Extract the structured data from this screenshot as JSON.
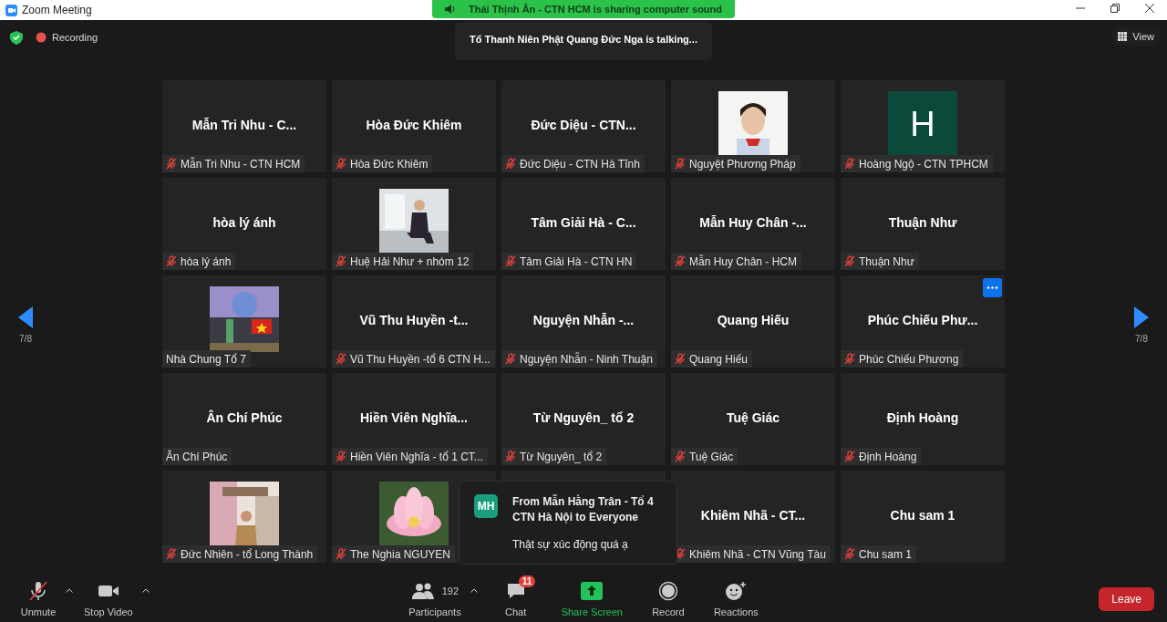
{
  "window": {
    "title": "Zoom Meeting"
  },
  "sharing_banner": "Thái Thịnh Ân - CTN HCM is sharing computer sound",
  "top_bar": {
    "recording": "Recording",
    "talking": "Tổ Thanh Niên Phật Quang Đức Nga is talking...",
    "view": "View"
  },
  "pager": {
    "left": "7/8",
    "right": "7/8"
  },
  "tiles": [
    {
      "kind": "name",
      "name": "Mẫn Tri Nhu - C...",
      "label": "Mẫn Tri Nhu - CTN HCM",
      "muted": true
    },
    {
      "kind": "name",
      "name": "Hòa Đức Khiêm",
      "label": "Hòa Đức Khiêm",
      "muted": true
    },
    {
      "kind": "name",
      "name": "Đức Diệu - CTN...",
      "label": "Đức Diệu - CTN Hà Tĩnh",
      "muted": true
    },
    {
      "kind": "picture",
      "label": "Nguyệt Phương Pháp",
      "muted": true
    },
    {
      "kind": "avatar",
      "initial": "H",
      "label": "Hoàng Ngộ - CTN TPHCM",
      "muted": true
    },
    {
      "kind": "name",
      "name": "hòa lý ánh",
      "label": "hòa lý ánh",
      "muted": true
    },
    {
      "kind": "picture",
      "label": "Huệ Hải Như + nhóm 12",
      "muted": true
    },
    {
      "kind": "name",
      "name": "Tâm Giải Hà - C...",
      "label": "Tâm Giải Hà - CTN HN",
      "muted": true
    },
    {
      "kind": "name",
      "name": "Mẫn Huy Chân -...",
      "label": "Mẫn Huy Chân - HCM",
      "muted": true
    },
    {
      "kind": "name",
      "name": "Thuận Như",
      "label": "Thuận Như",
      "muted": true
    },
    {
      "kind": "picture",
      "label": "Nhà Chung Tổ 7",
      "muted": false
    },
    {
      "kind": "name",
      "name": "Vũ Thu Huyền -t...",
      "label": "Vũ Thu Huyền -tổ 6 CTN H...",
      "muted": true
    },
    {
      "kind": "name",
      "name": "Nguyện Nhẫn -...",
      "label": "Nguyện Nhẫn - Ninh Thuận",
      "muted": true
    },
    {
      "kind": "name",
      "name": "Quang Hiếu",
      "label": "Quang Hiếu",
      "muted": true
    },
    {
      "kind": "name",
      "name": "Phúc Chiếu Phư...",
      "label": "Phúc Chiếu Phương",
      "muted": true,
      "hovered": true
    },
    {
      "kind": "name",
      "name": "Ân Chí Phúc",
      "label": "Ân Chí Phúc",
      "muted": false
    },
    {
      "kind": "name",
      "name": "Hiền Viên Nghĩa...",
      "label": "Hiền Viên Nghĩa - tổ 1 CT...",
      "muted": true
    },
    {
      "kind": "name",
      "name": "Từ Nguyên_ tổ 2",
      "label": "Từ Nguyên_ tổ 2",
      "muted": true
    },
    {
      "kind": "name",
      "name": "Tuệ Giác",
      "label": "Tuệ Giác",
      "muted": true
    },
    {
      "kind": "name",
      "name": "Định Hoàng",
      "label": "Định Hoàng",
      "muted": true
    },
    {
      "kind": "picture",
      "label": "Đức Nhiên - tổ Long Thành",
      "muted": true
    },
    {
      "kind": "picture",
      "label": "The Nghia NGUYEN",
      "muted": true
    },
    {
      "kind": "covered"
    },
    {
      "kind": "name",
      "name": "Khiêm Nhã - CT...",
      "label": "Khiêm Nhã - CTN Vũng Tàu",
      "muted": true
    },
    {
      "kind": "name",
      "name": "Chu sam 1",
      "label": "Chu sam 1",
      "muted": true
    }
  ],
  "chat_popup": {
    "initials": "MH",
    "title_lines": [
      "From Mẫn Hằng Trân - Tổ 4",
      "CTN Hà Nội to Everyone"
    ],
    "message": "Thật sự xúc động quá ạ"
  },
  "toolbar": [
    {
      "kind": "mic",
      "label": "Unmute",
      "caret": true
    },
    {
      "kind": "video",
      "label": "Stop Video",
      "caret": true
    },
    {
      "kind": "participants",
      "label": "Participants",
      "count": "192",
      "caret": true
    },
    {
      "kind": "chat",
      "label": "Chat",
      "badge": "11"
    },
    {
      "kind": "share",
      "label": "Share Screen"
    },
    {
      "kind": "record",
      "label": "Record"
    },
    {
      "kind": "reactions",
      "label": "Reactions"
    }
  ],
  "leave": "Leave"
}
